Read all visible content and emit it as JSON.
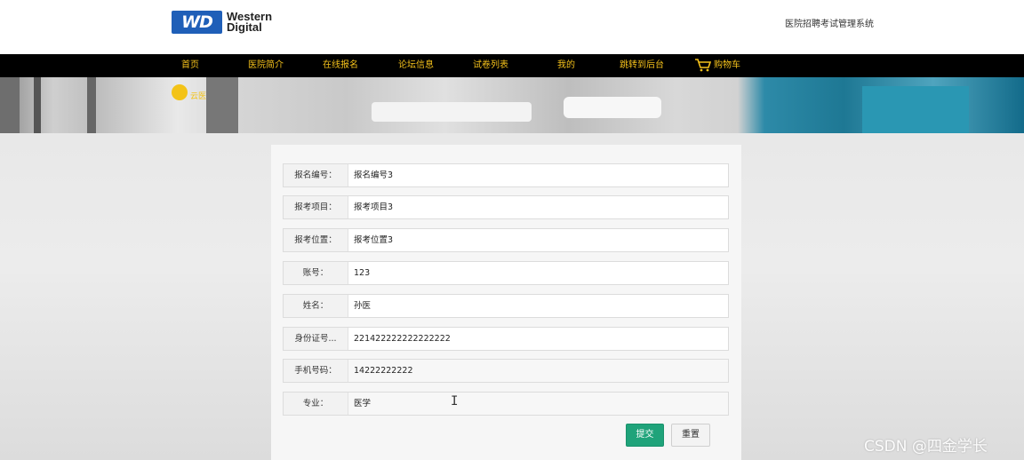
{
  "header": {
    "logo_badge": "WD",
    "logo_line1": "Western",
    "logo_line2": "Digital",
    "site_title": "医院招聘考试管理系统"
  },
  "nav": {
    "items": [
      {
        "label": "首页"
      },
      {
        "label": "医院简介"
      },
      {
        "label": "在线报名"
      },
      {
        "label": "论坛信息"
      },
      {
        "label": "试卷列表"
      },
      {
        "label": "我的"
      },
      {
        "label": "跳转到后台"
      },
      {
        "label": "购物车"
      }
    ]
  },
  "banner": {
    "logo_text": "云医"
  },
  "form": {
    "fields": [
      {
        "label": "报名编号：",
        "value": "报名编号3"
      },
      {
        "label": "报考项目：",
        "value": "报考项目3"
      },
      {
        "label": "报考位置：",
        "value": "报考位置3"
      },
      {
        "label": "账号：",
        "value": "123"
      },
      {
        "label": "姓名：",
        "value": "孙医"
      },
      {
        "label": "身份证号...",
        "value": "221422222222222222"
      },
      {
        "label": "手机号码：",
        "value": "14222222222"
      },
      {
        "label": "专业：",
        "value": "医学"
      }
    ],
    "submit_label": "提交",
    "reset_label": "重置"
  },
  "watermark": "CSDN @四金学长",
  "colors": {
    "nav_bg": "#000000",
    "nav_text": "#f4c11b",
    "submit_bg": "#1fa37a",
    "logo_blue": "#1f5fb8"
  },
  "icons": [
    "cart-icon",
    "banner-logo-icon",
    "text-cursor-icon"
  ]
}
